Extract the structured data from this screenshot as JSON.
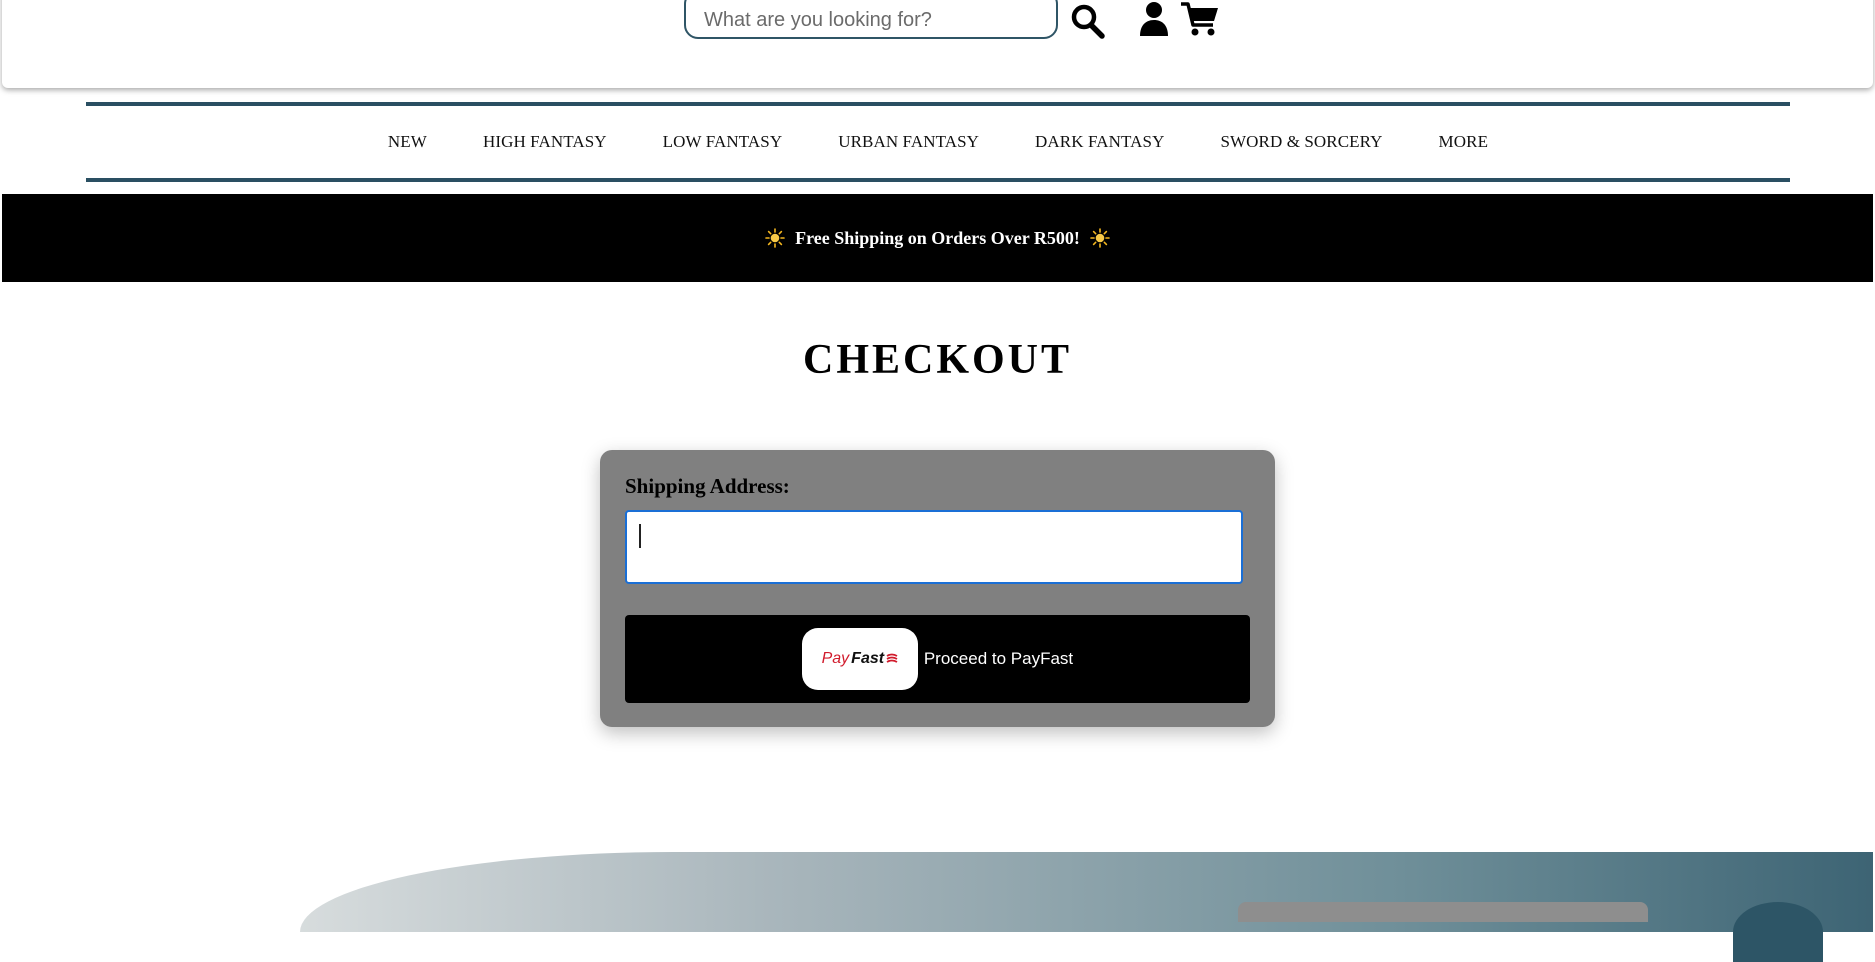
{
  "header": {
    "search_placeholder": "What are you looking for?",
    "icons": [
      "search-icon",
      "user-icon",
      "cart-icon"
    ]
  },
  "nav": {
    "items": [
      "NEW",
      "HIGH FANTASY",
      "LOW FANTASY",
      "URBAN FANTASY",
      "DARK FANTASY",
      "SWORD & SORCERY",
      "MORE"
    ]
  },
  "promo": {
    "text": "Free Shipping on Orders Over R500!",
    "icon": "sun-icon"
  },
  "checkout": {
    "title": "CHECKOUT",
    "shipping_label": "Shipping Address:",
    "shipping_value": "",
    "payfast_logo_pay": "Pay",
    "payfast_logo_fast": "Fast",
    "pay_button_label": "Proceed to PayFast"
  },
  "colors": {
    "accent": "#2a4f62",
    "card_bg": "#808080",
    "banner_bg": "#000000",
    "payfast_red": "#d11b2c",
    "focus_blue": "#1a6fd6"
  }
}
